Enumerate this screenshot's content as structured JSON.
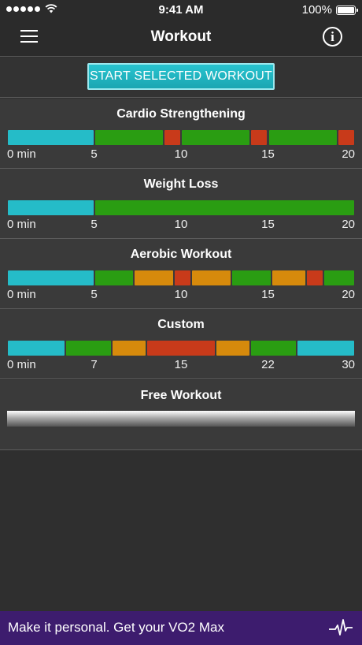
{
  "status": {
    "time": "9:41 AM",
    "battery": "100%",
    "battery_level": 1.0
  },
  "nav": {
    "title": "Workout"
  },
  "start_button": {
    "label": "START SELECTED WORKOUT"
  },
  "colors": {
    "cyan": "#25bcc8",
    "green": "#2a9d12",
    "orange": "#d68a0c",
    "red": "#c83a1a",
    "banner": "#3d1c6e"
  },
  "workouts": [
    {
      "name": "Cardio Strengthening",
      "total": 20,
      "ticks": [
        "0 min",
        "5",
        "10",
        "15",
        "20"
      ],
      "tick_values": [
        0,
        5,
        10,
        15,
        20
      ],
      "segments": [
        {
          "zone": "cyan",
          "minutes": 5
        },
        {
          "zone": "green",
          "minutes": 4
        },
        {
          "zone": "red",
          "minutes": 1
        },
        {
          "zone": "green",
          "minutes": 4
        },
        {
          "zone": "red",
          "minutes": 1
        },
        {
          "zone": "green",
          "minutes": 4
        },
        {
          "zone": "red",
          "minutes": 1
        }
      ]
    },
    {
      "name": "Weight Loss",
      "total": 20,
      "ticks": [
        "0 min",
        "5",
        "10",
        "15",
        "20"
      ],
      "tick_values": [
        0,
        5,
        10,
        15,
        20
      ],
      "segments": [
        {
          "zone": "cyan",
          "minutes": 5
        },
        {
          "zone": "green",
          "minutes": 15
        }
      ]
    },
    {
      "name": "Aerobic Workout",
      "total": 20,
      "ticks": [
        "0 min",
        "5",
        "10",
        "15",
        "20"
      ],
      "tick_values": [
        0,
        5,
        10,
        15,
        20
      ],
      "segments": [
        {
          "zone": "cyan",
          "minutes": 5
        },
        {
          "zone": "green",
          "minutes": 2.3
        },
        {
          "zone": "orange",
          "minutes": 2.3
        },
        {
          "zone": "red",
          "minutes": 1
        },
        {
          "zone": "orange",
          "minutes": 2.3
        },
        {
          "zone": "green",
          "minutes": 2.3
        },
        {
          "zone": "orange",
          "minutes": 2
        },
        {
          "zone": "red",
          "minutes": 1
        },
        {
          "zone": "green",
          "minutes": 1.8
        }
      ]
    },
    {
      "name": "Custom",
      "total": 30,
      "ticks": [
        "0 min",
        "7",
        "15",
        "22",
        "30"
      ],
      "tick_values": [
        0,
        7.5,
        15,
        22.5,
        30
      ],
      "segments": [
        {
          "zone": "cyan",
          "minutes": 5
        },
        {
          "zone": "green",
          "minutes": 4
        },
        {
          "zone": "orange",
          "minutes": 3
        },
        {
          "zone": "red",
          "minutes": 6
        },
        {
          "zone": "orange",
          "minutes": 3
        },
        {
          "zone": "green",
          "minutes": 4
        },
        {
          "zone": "cyan",
          "minutes": 5
        }
      ]
    }
  ],
  "free_workout": {
    "name": "Free Workout"
  },
  "banner": {
    "text": "Make it personal. Get your VO2 Max",
    "icon": "pulse-icon"
  }
}
